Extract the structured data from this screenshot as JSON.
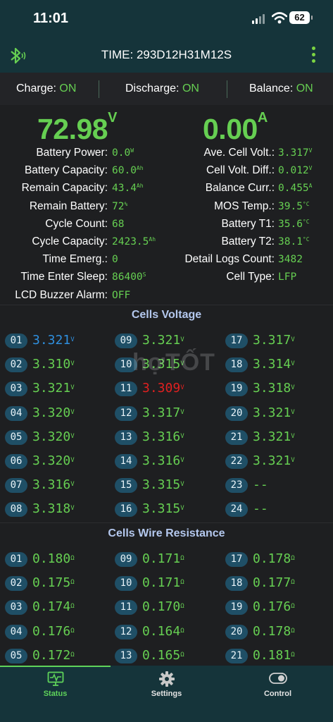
{
  "status_bar": {
    "time": "11:01",
    "battery": "62"
  },
  "header": {
    "time_label": "TIME: 293D12H31M12S"
  },
  "switches": [
    {
      "label": "Charge:",
      "value": "ON"
    },
    {
      "label": "Discharge:",
      "value": "ON"
    },
    {
      "label": "Balance:",
      "value": "ON"
    }
  ],
  "summary": {
    "voltage": "72.98",
    "voltage_unit": "V",
    "current": "0.00",
    "current_unit": "A"
  },
  "left_info": [
    {
      "label": "Battery Power:",
      "value": "0.0",
      "unit": "W"
    },
    {
      "label": "Battery Capacity:",
      "value": "60.0",
      "unit": "Ah"
    },
    {
      "label": "Remain Capacity:",
      "value": "43.4",
      "unit": "Ah"
    },
    {
      "label": "Remain Battery:",
      "value": "72",
      "unit": "%"
    },
    {
      "label": "Cycle Count:",
      "value": "68",
      "unit": ""
    },
    {
      "label": "Cycle Capacity:",
      "value": "2423.5",
      "unit": "Ah"
    },
    {
      "label": "Time Emerg.:",
      "value": "0",
      "unit": ""
    },
    {
      "label": "Time Enter Sleep:",
      "value": "86400",
      "unit": "S"
    },
    {
      "label": "LCD Buzzer Alarm:",
      "value": "OFF",
      "unit": ""
    }
  ],
  "right_info": [
    {
      "label": "Ave. Cell Volt.:",
      "value": "3.317",
      "unit": "V"
    },
    {
      "label": "Cell Volt. Diff.:",
      "value": "0.012",
      "unit": "V"
    },
    {
      "label": "Balance Curr.:",
      "value": "0.455",
      "unit": "A"
    },
    {
      "label": "MOS Temp.:",
      "value": "39.5",
      "unit": "°C"
    },
    {
      "label": "Battery T1:",
      "value": "35.6",
      "unit": "°C"
    },
    {
      "label": "Battery T2:",
      "value": "38.1",
      "unit": "°C"
    },
    {
      "label": "Detail Logs Count:",
      "value": "3482",
      "unit": ""
    },
    {
      "label": "Cell Type:",
      "value": "LFP",
      "unit": ""
    }
  ],
  "cells_voltage": {
    "title": "Cells Voltage",
    "unit": "V",
    "cells": [
      {
        "id": "01",
        "value": "3.321",
        "state": "min"
      },
      {
        "id": "02",
        "value": "3.310",
        "state": ""
      },
      {
        "id": "03",
        "value": "3.321",
        "state": ""
      },
      {
        "id": "04",
        "value": "3.320",
        "state": ""
      },
      {
        "id": "05",
        "value": "3.320",
        "state": ""
      },
      {
        "id": "06",
        "value": "3.320",
        "state": ""
      },
      {
        "id": "07",
        "value": "3.316",
        "state": ""
      },
      {
        "id": "08",
        "value": "3.318",
        "state": ""
      },
      {
        "id": "09",
        "value": "3.321",
        "state": ""
      },
      {
        "id": "10",
        "value": "3.315",
        "state": ""
      },
      {
        "id": "11",
        "value": "3.309",
        "state": "low"
      },
      {
        "id": "12",
        "value": "3.317",
        "state": ""
      },
      {
        "id": "13",
        "value": "3.316",
        "state": ""
      },
      {
        "id": "14",
        "value": "3.316",
        "state": ""
      },
      {
        "id": "15",
        "value": "3.315",
        "state": ""
      },
      {
        "id": "16",
        "value": "3.315",
        "state": ""
      },
      {
        "id": "17",
        "value": "3.317",
        "state": ""
      },
      {
        "id": "18",
        "value": "3.314",
        "state": ""
      },
      {
        "id": "19",
        "value": "3.318",
        "state": ""
      },
      {
        "id": "20",
        "value": "3.321",
        "state": ""
      },
      {
        "id": "21",
        "value": "3.321",
        "state": ""
      },
      {
        "id": "22",
        "value": "3.321",
        "state": ""
      },
      {
        "id": "23",
        "value": "--",
        "state": "empty"
      },
      {
        "id": "24",
        "value": "--",
        "state": "empty"
      }
    ]
  },
  "watermark": "hợTỐT",
  "cells_resistance": {
    "title": "Cells Wire Resistance",
    "unit": "Ω",
    "cells": [
      {
        "id": "01",
        "value": "0.180"
      },
      {
        "id": "02",
        "value": "0.175"
      },
      {
        "id": "03",
        "value": "0.174"
      },
      {
        "id": "04",
        "value": "0.176"
      },
      {
        "id": "05",
        "value": "0.172"
      },
      {
        "id": "09",
        "value": "0.171"
      },
      {
        "id": "10",
        "value": "0.171"
      },
      {
        "id": "11",
        "value": "0.170"
      },
      {
        "id": "12",
        "value": "0.164"
      },
      {
        "id": "13",
        "value": "0.165"
      },
      {
        "id": "17",
        "value": "0.178"
      },
      {
        "id": "18",
        "value": "0.177"
      },
      {
        "id": "19",
        "value": "0.176"
      },
      {
        "id": "20",
        "value": "0.178"
      },
      {
        "id": "21",
        "value": "0.181"
      }
    ]
  },
  "bottom_nav": [
    {
      "label": "Status",
      "icon": "status-monitor-icon",
      "active": true
    },
    {
      "label": "Settings",
      "icon": "gear-icon",
      "active": false
    },
    {
      "label": "Control",
      "icon": "toggle-icon",
      "active": false
    }
  ],
  "colors": {
    "accent_green": "#66cf52",
    "header_bg": "#15343a",
    "pill_bg": "#1f4f66",
    "min_cell": "#2f8fde",
    "low_cell": "#e02020",
    "nav_active": "#5fd35a",
    "section_title": "#b4c8ee"
  }
}
